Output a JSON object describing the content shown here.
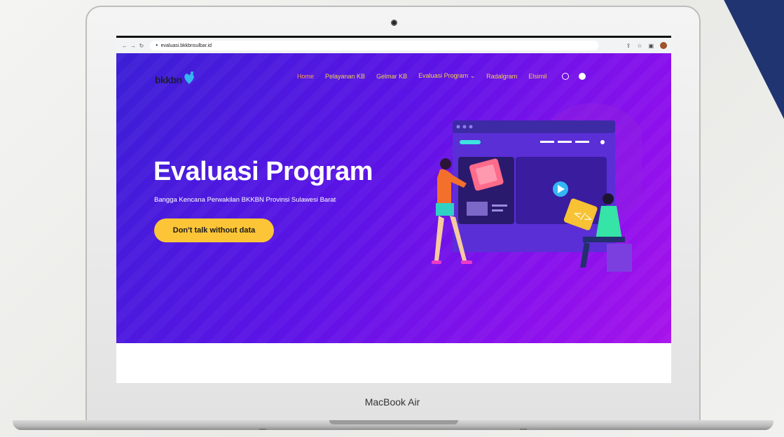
{
  "laptop": {
    "model_label": "MacBook Air"
  },
  "browser": {
    "url": "evaluasi.bkkbnsulbar.id",
    "nav_icons": [
      "back-icon",
      "forward-icon",
      "reload-icon"
    ],
    "toolbar_icons": [
      "share-icon",
      "bookmark-star-icon",
      "sidebar-icon",
      "profile-avatar"
    ]
  },
  "site": {
    "logo_text": "bkkbn",
    "nav": {
      "home": "Home",
      "pelayanan": "Pelayanan KB",
      "gelmar": "Gelmar KB",
      "evaluasi": "Evaluasi Program",
      "radalgram": "Radalgram",
      "elsimil": "Elsimil"
    },
    "social_icons": [
      "instagram-icon",
      "facebook-icon"
    ],
    "hero": {
      "title": "Evaluasi Program",
      "subtitle": "Bangga Kencana Perwakilan BKKBN Provinsi Sulawesi Barat",
      "cta": "Don't talk without data"
    }
  },
  "colors": {
    "hero_gradient_start": "#3b1fd6",
    "hero_gradient_end": "#a713ea",
    "cta": "#fcc537",
    "nav_text": "#f3d24f",
    "nav_active": "#ff9f43",
    "corner_accent": "#1f3470"
  }
}
